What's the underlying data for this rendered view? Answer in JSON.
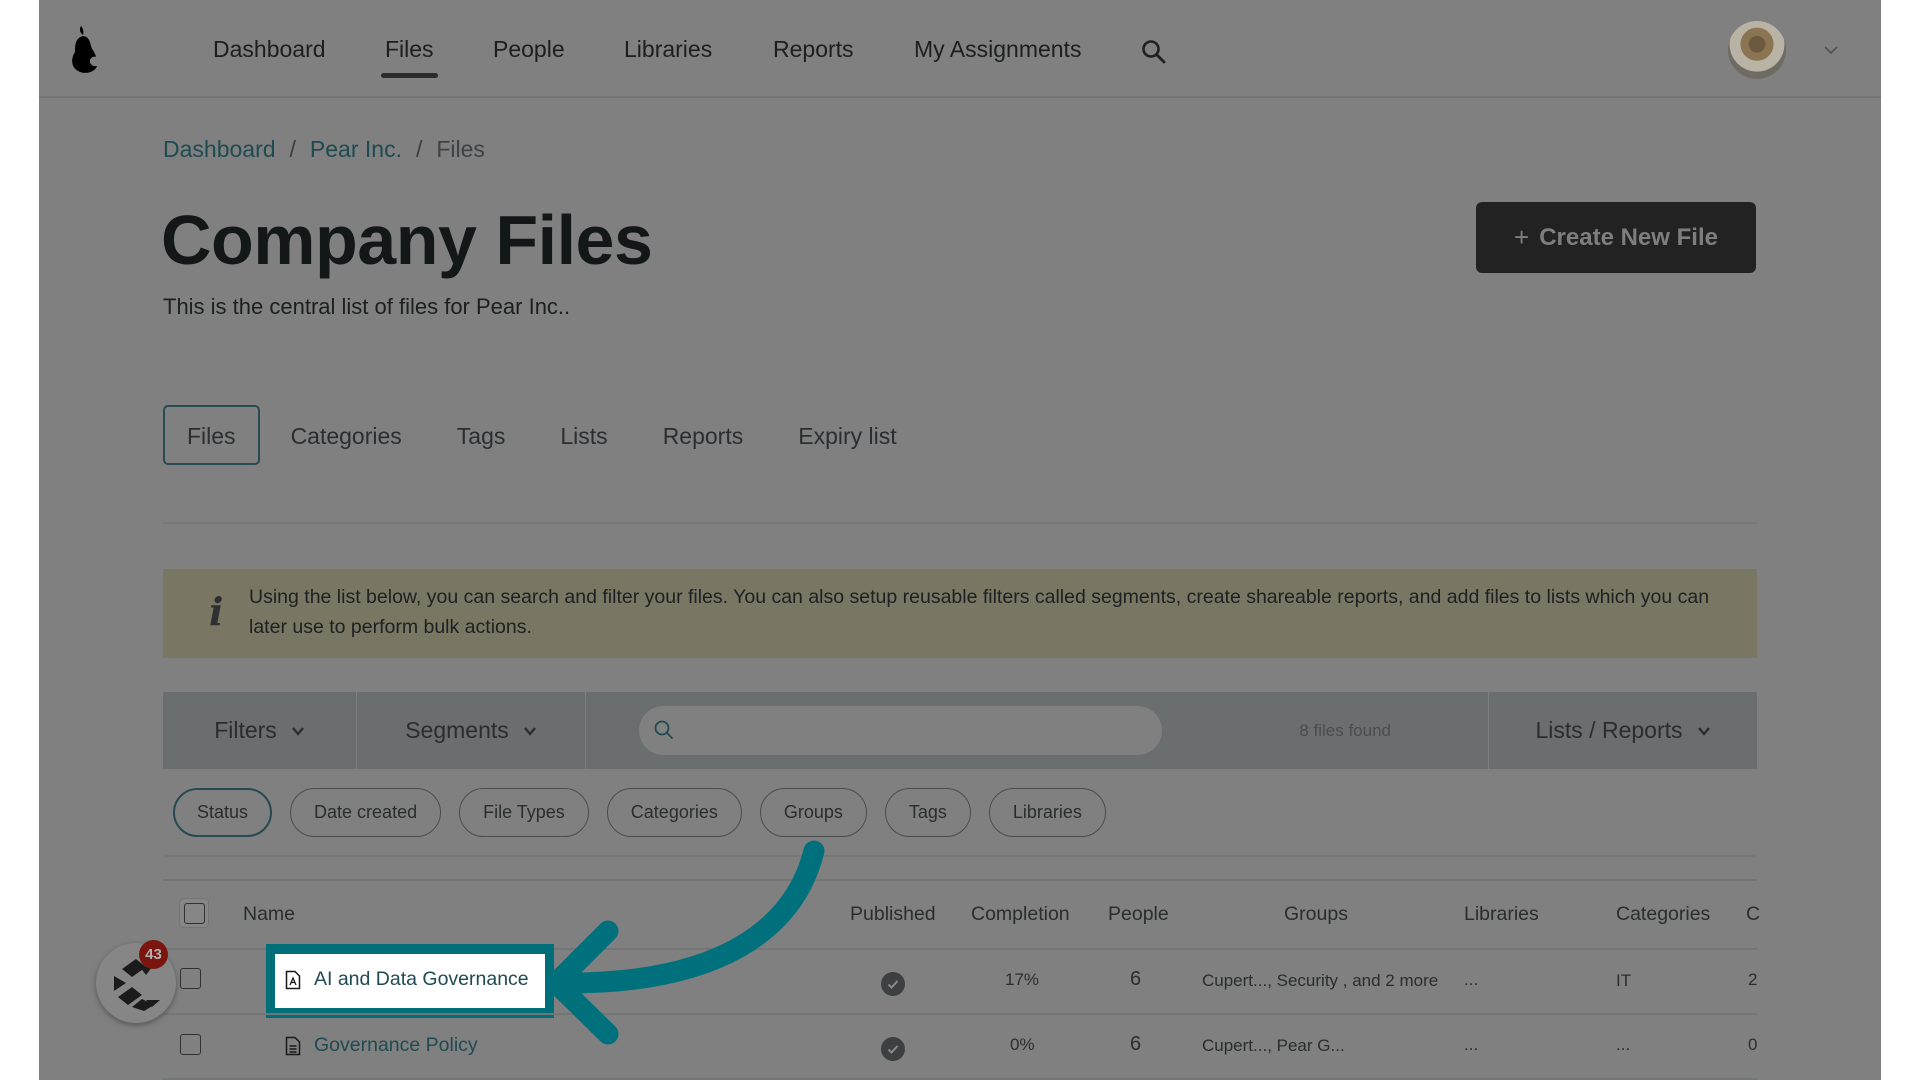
{
  "nav": {
    "logo": "pear-logo",
    "items": [
      {
        "label": "Dashboard",
        "active": false
      },
      {
        "label": "Files",
        "active": true
      },
      {
        "label": "People",
        "active": false
      },
      {
        "label": "Libraries",
        "active": false
      },
      {
        "label": "Reports",
        "active": false
      },
      {
        "label": "My Assignments",
        "active": false
      }
    ],
    "search_icon": "search-icon",
    "avatar": "user-avatar",
    "account_menu_icon": "chevron-down-icon"
  },
  "breadcrumb": [
    {
      "label": "Dashboard",
      "link": true
    },
    {
      "label": "Pear Inc.",
      "link": true
    },
    {
      "label": "Files",
      "link": false
    }
  ],
  "breadcrumb_separator": "/",
  "header": {
    "title": "Company Files",
    "description": "This is the central list of files for Pear Inc..",
    "create_button_icon": "+",
    "create_button_label": "Create New File"
  },
  "tabs": [
    {
      "label": "Files",
      "active": true
    },
    {
      "label": "Categories",
      "active": false
    },
    {
      "label": "Tags",
      "active": false
    },
    {
      "label": "Lists",
      "active": false
    },
    {
      "label": "Reports",
      "active": false
    },
    {
      "label": "Expiry list",
      "active": false
    }
  ],
  "info_banner": {
    "icon": "i",
    "text": "Using the list below, you can search and filter your files. You can also setup reusable filters called segments, create shareable reports, and add files to lists which you can later use to perform bulk actions."
  },
  "toolbar": {
    "filters_label": "Filters",
    "segments_label": "Segments",
    "search_placeholder": "",
    "search_value": "",
    "files_found": "8 files found",
    "lists_reports_label": "Lists / Reports"
  },
  "filter_chips": [
    {
      "label": "Status",
      "active": true
    },
    {
      "label": "Date created",
      "active": false
    },
    {
      "label": "File Types",
      "active": false
    },
    {
      "label": "Categories",
      "active": false
    },
    {
      "label": "Groups",
      "active": false
    },
    {
      "label": "Tags",
      "active": false
    },
    {
      "label": "Libraries",
      "active": false
    }
  ],
  "table": {
    "columns": [
      "Name",
      "Published",
      "Completion",
      "People",
      "Groups",
      "Libraries",
      "Categories",
      "C"
    ],
    "rows": [
      {
        "name": "AI and Data Governance",
        "file_icon": "pdf-file-icon",
        "published": true,
        "completion": "17%",
        "people": "6",
        "groups": "Cupert..., Security , and 2 more",
        "libraries": "...",
        "categories": "IT",
        "c": "2",
        "highlighted": true
      },
      {
        "name": "Governance Policy",
        "file_icon": "document-file-icon",
        "published": true,
        "completion": "0%",
        "people": "6",
        "groups": "Cupert..., Pear G...",
        "libraries": "...",
        "categories": "...",
        "c": "0",
        "highlighted": false
      }
    ]
  },
  "widget": {
    "icon": "c-logo-icon",
    "badge_count": "43"
  },
  "overlay": {
    "dim_color": "#808080",
    "highlight_color": "#006e78",
    "arrow_color": "#00717c"
  }
}
